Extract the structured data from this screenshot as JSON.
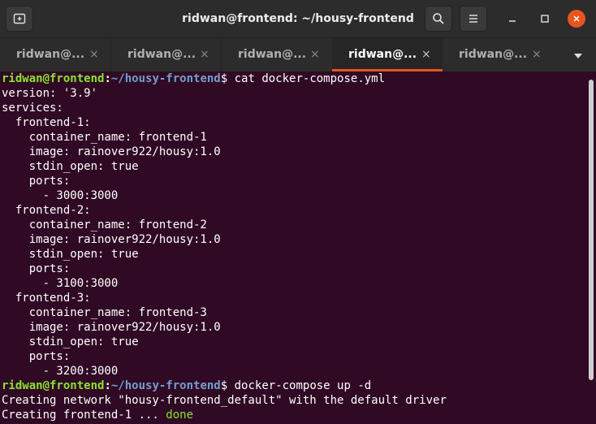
{
  "window": {
    "title": "ridwan@frontend: ~/housy-frontend"
  },
  "tabs": [
    {
      "label": "ridwan@...",
      "active": false
    },
    {
      "label": "ridwan@...",
      "active": false
    },
    {
      "label": "ridwan@...",
      "active": false
    },
    {
      "label": "ridwan@...",
      "active": true
    },
    {
      "label": "ridwan@...",
      "active": false
    }
  ],
  "tab_close_glyph": "×",
  "prompt": {
    "user": "ridwan@frontend",
    "colon": ":",
    "path": "~/housy-frontend",
    "symbol": "$"
  },
  "commands": {
    "first": " cat docker-compose.yml",
    "second": " docker-compose up -d"
  },
  "output": {
    "compose_lines": [
      "version: '3.9'",
      "services:",
      "  frontend-1:",
      "    container_name: frontend-1",
      "    image: rainover922/housy:1.0",
      "    stdin_open: true",
      "    ports:",
      "      - 3000:3000",
      "  frontend-2:",
      "    container_name: frontend-2",
      "    image: rainover922/housy:1.0",
      "    stdin_open: true",
      "    ports:",
      "      - 3100:3000",
      "  frontend-3:",
      "    container_name: frontend-3",
      "    image: rainover922/housy:1.0",
      "    stdin_open: true",
      "    ports:",
      "      - 3200:3000"
    ],
    "network_line": "Creating network \"housy-frontend_default\" with the default driver",
    "creating_prefix": "Creating frontend-1 ... ",
    "creating_status": "done"
  },
  "icons": {
    "new_tab": "new-tab-icon",
    "search": "search-icon",
    "menu": "hamburger-menu-icon",
    "minimize": "minimize-icon",
    "maximize": "maximize-icon",
    "close": "close-icon",
    "tabs_dropdown": "chevron-down-icon"
  },
  "colors": {
    "terminal_bg": "#300a24",
    "prompt_user": "#8ae234",
    "prompt_path": "#729fcf",
    "accent": "#e95420"
  }
}
